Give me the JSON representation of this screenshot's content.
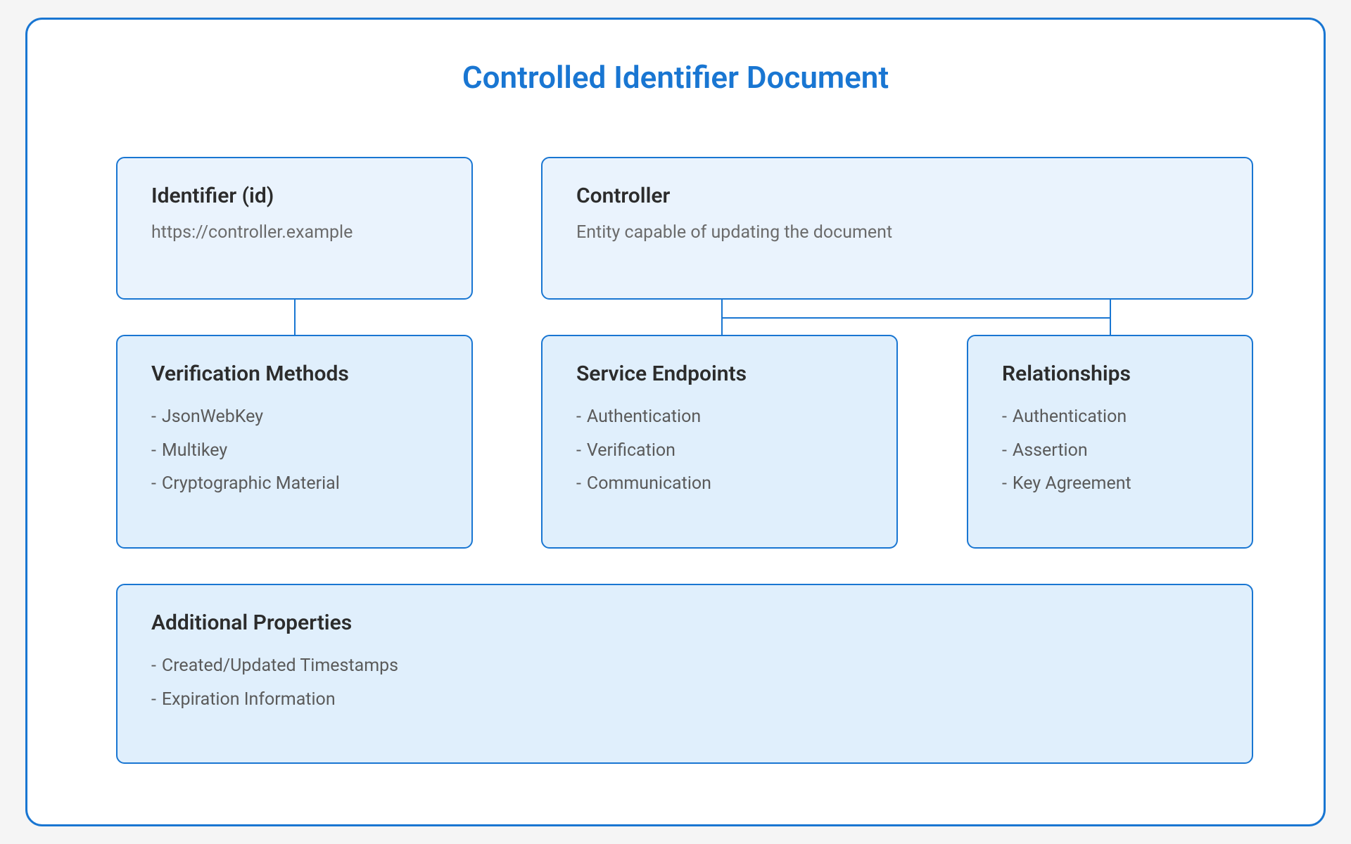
{
  "diagram": {
    "title": "Controlled Identifier Document",
    "identifier": {
      "heading": "Identifier (id)",
      "value": "https://controller.example"
    },
    "controller": {
      "heading": "Controller",
      "description": "Entity capable of updating the document"
    },
    "verification_methods": {
      "heading": "Verification Methods",
      "items": [
        "JsonWebKey",
        "Multikey",
        "Cryptographic Material"
      ]
    },
    "service_endpoints": {
      "heading": "Service Endpoints",
      "items": [
        "Authentication",
        "Verification",
        "Communication"
      ]
    },
    "relationships": {
      "heading": "Relationships",
      "items": [
        "Authentication",
        "Assertion",
        "Key Agreement"
      ]
    },
    "additional": {
      "heading": "Additional Properties",
      "items": [
        "Created/Updated Timestamps",
        "Expiration Information"
      ]
    }
  }
}
